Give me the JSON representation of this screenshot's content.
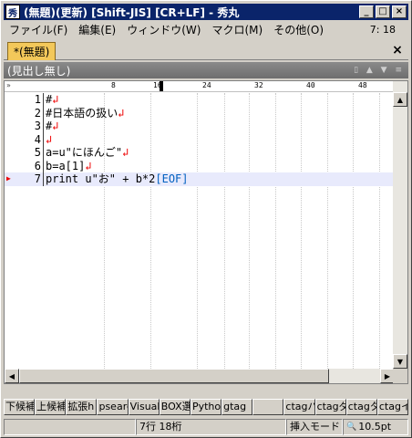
{
  "window": {
    "title": "(無題)(更新) [Shift-JIS] [CR+LF] - 秀丸",
    "icon": "hidemaru-app-icon",
    "minimize": "_",
    "maximize": "□",
    "close": "×"
  },
  "menu": {
    "items": [
      "ファイル(F)",
      "編集(E)",
      "ウィンドウ(W)",
      "マクロ(M)",
      "その他(O)"
    ],
    "cursor_pos": "7: 18"
  },
  "tab": {
    "label": "*(無題)",
    "close": "×"
  },
  "outline": {
    "label": "(見出し無し)"
  },
  "ruler": {
    "numbers": [
      "8",
      "16",
      "24",
      "32",
      "40",
      "48"
    ],
    "corner": "»"
  },
  "editor": {
    "lines": [
      {
        "num": "1",
        "text": "#",
        "nl": "↲"
      },
      {
        "num": "2",
        "text": "#日本語の扱い",
        "nl": "↲"
      },
      {
        "num": "3",
        "text": "#",
        "nl": "↲"
      },
      {
        "num": "4",
        "text": "",
        "nl": "↲"
      },
      {
        "num": "5",
        "text": "a=u\"にほんご\"",
        "nl": "↲"
      },
      {
        "num": "6",
        "text": "b=a[1]",
        "nl": "↲"
      },
      {
        "num": "7",
        "text": "print u\"お\" + b*2",
        "nl": "[EOF]"
      }
    ]
  },
  "function_keys": [
    "下候補",
    "上候補",
    "拡張h",
    "psearc",
    "Visual",
    "BOX選",
    "Python",
    "gtag",
    "",
    "ctagバ",
    "ctagダ",
    "ctagタ",
    "ctagイ"
  ],
  "status": {
    "position": "7行 18桁",
    "mode": "挿入モード",
    "zoom": "10.5pt"
  }
}
